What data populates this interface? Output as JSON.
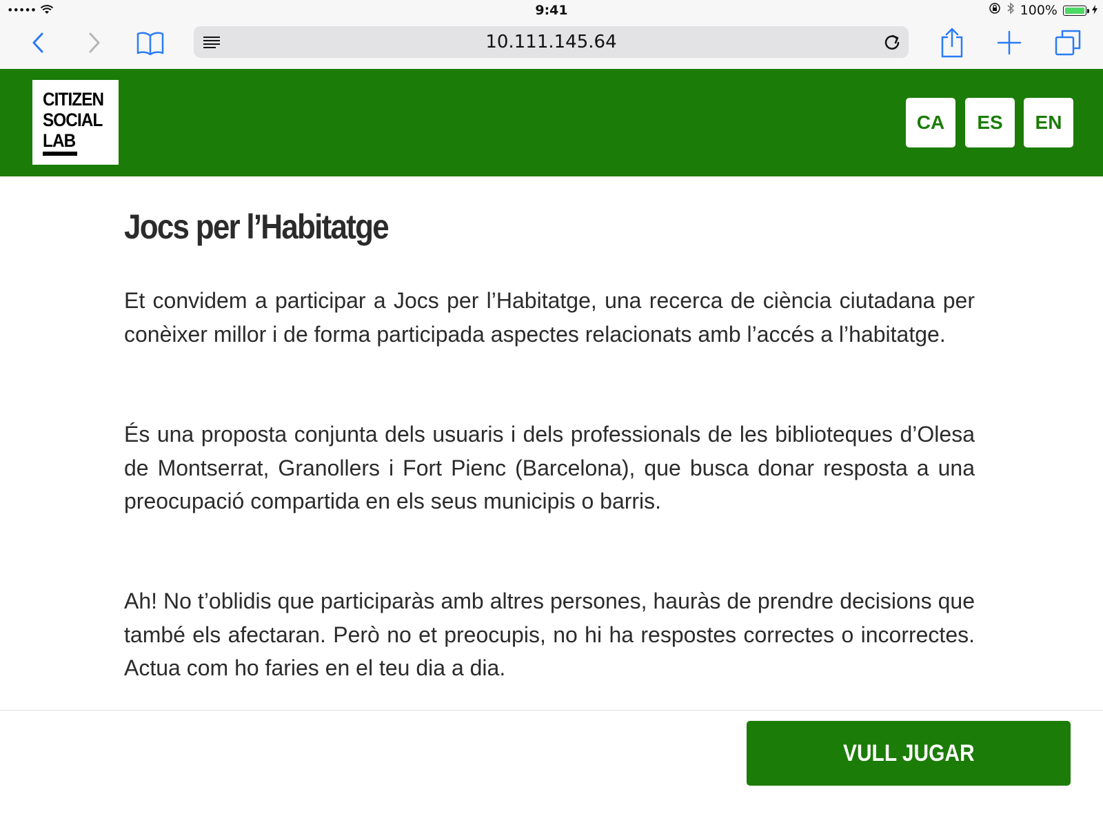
{
  "status_bar": {
    "signal": "•••••",
    "time": "9:41",
    "battery_percent": "100%",
    "battery_level": 1.0
  },
  "browser": {
    "url": "10.111.145.64",
    "icons": [
      "back-icon",
      "forward-icon",
      "bookmarks-icon",
      "reader-icon",
      "reload-icon",
      "share-icon",
      "new-tab-icon",
      "tabs-icon"
    ]
  },
  "header": {
    "logo_lines": [
      "CITIZEN",
      "SOCIAL",
      "LAB"
    ],
    "languages": [
      "CA",
      "ES",
      "EN"
    ]
  },
  "main": {
    "title": "Jocs per l’Habitatge",
    "paragraphs": [
      "Et convidem a participar a Jocs per l’Habitatge, una recerca de ciència ciutadana per conèixer millor i de forma participada aspectes relacionats amb l’accés a l’habitatge.",
      "És una proposta conjunta dels usuaris i dels professionals de les biblioteques d’Olesa de Montserrat, Granollers i Fort Pienc (Barcelona), que busca donar resposta a una preocupació compartida en els seus municipis o barris.",
      "Ah! No t’oblidis que participaràs amb altres persones, hauràs de prendre decisions que també els afectaran. Però no et preocupis, no hi ha respostes correctes o incorrectes. Actua com ho faries en el teu dia a dia."
    ]
  },
  "footer": {
    "play_label": "VULL JUGAR"
  },
  "colors": {
    "brand_green": "#1b7c07",
    "ios_blue": "#2a7bf6",
    "text": "#2b2b2b"
  }
}
